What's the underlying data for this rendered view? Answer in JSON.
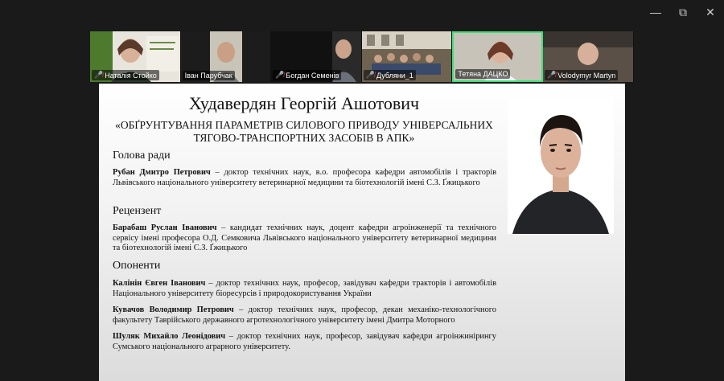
{
  "window": {
    "minimize_label": "—",
    "maximize_label": "⧉",
    "close_label": "✕"
  },
  "participants": [
    {
      "name": "Наталія Стойко",
      "muted": true
    },
    {
      "name": "Іван Парубчак",
      "muted": false
    },
    {
      "name": "Богдан Семенів",
      "muted": true
    },
    {
      "name": "Дубляни_1",
      "muted": true
    },
    {
      "name": "Тетяна ДАЦКО",
      "muted": false,
      "active": true
    },
    {
      "name": "Volodymyr Martyn",
      "muted": true
    }
  ],
  "slide": {
    "title": "Худавердян Георгій Ашотович",
    "subtitle_line1": "«ОБҐРУНТУВАННЯ ПАРАМЕТРІВ СИЛОВОГО ПРИВОДУ УНІВЕРСАЛЬНИХ",
    "subtitle_line2": "ТЯГОВО-ТРАНСПОРТНИХ ЗАСОБІВ В АПК»",
    "chair_heading": "Голова ради",
    "chair": {
      "name": "Рубан Дмитро Петрович",
      "desc": " – доктор технічних наук, в.о. професора кафедри автомобілів і тракторів Львівського національного університету ветеринарної медицини та біотехнологій імені С.З. Ґжицького"
    },
    "reviewer_heading": "Рецензент",
    "reviewer": {
      "name": "Барабаш Руслан Іванович",
      "desc": " – кандидат технічних наук, доцент кафедри агроінженерії та технічного сервісу імені професора О.Д. Семковича Львівського національного університету ветеринарної медицини та біотехнологій імені С.З. Ґжицького"
    },
    "opponents_heading": "Опоненти",
    "opponents": [
      {
        "name": "Калінін Євген Іванович",
        "desc": " – доктор технічних наук, професор, завідувач кафедри тракторів і автомобілів Національного університету біоресурсів і природокористування України"
      },
      {
        "name": "Кувачов Володимир Петрович",
        "desc": " – доктор технічних наук, професор, декан механіко-технологічного факультету Таврійського державного агротехнологічного університету імені Дмитра Моторного"
      },
      {
        "name": "Шуляк Михайло Леонідович",
        "desc": " – доктор технічних наук, професор, завідувач кафедри агроінжинірингу Сумського національного аграрного університету."
      }
    ]
  },
  "colors": {
    "active_speaker_border": "#3ee07a",
    "muted_icon": "#e23b3b",
    "background": "#1a1a1a"
  }
}
